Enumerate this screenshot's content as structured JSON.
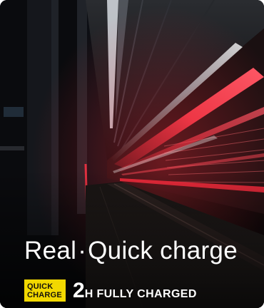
{
  "image": {
    "description_icon": "subway-tunnel-light-streak-photo"
  },
  "headline": {
    "part1": "Real",
    "separator": "·",
    "part2": "Quick charge"
  },
  "badge": {
    "line1": "QUICK",
    "line2": "CHARGE",
    "color": "#f2d800"
  },
  "charge_time": {
    "number": "2",
    "suffix": "H FULLY CHARGED"
  },
  "colors": {
    "accent_red": "#ff3a4a",
    "background": "#07080b",
    "text": "#ffffff"
  }
}
